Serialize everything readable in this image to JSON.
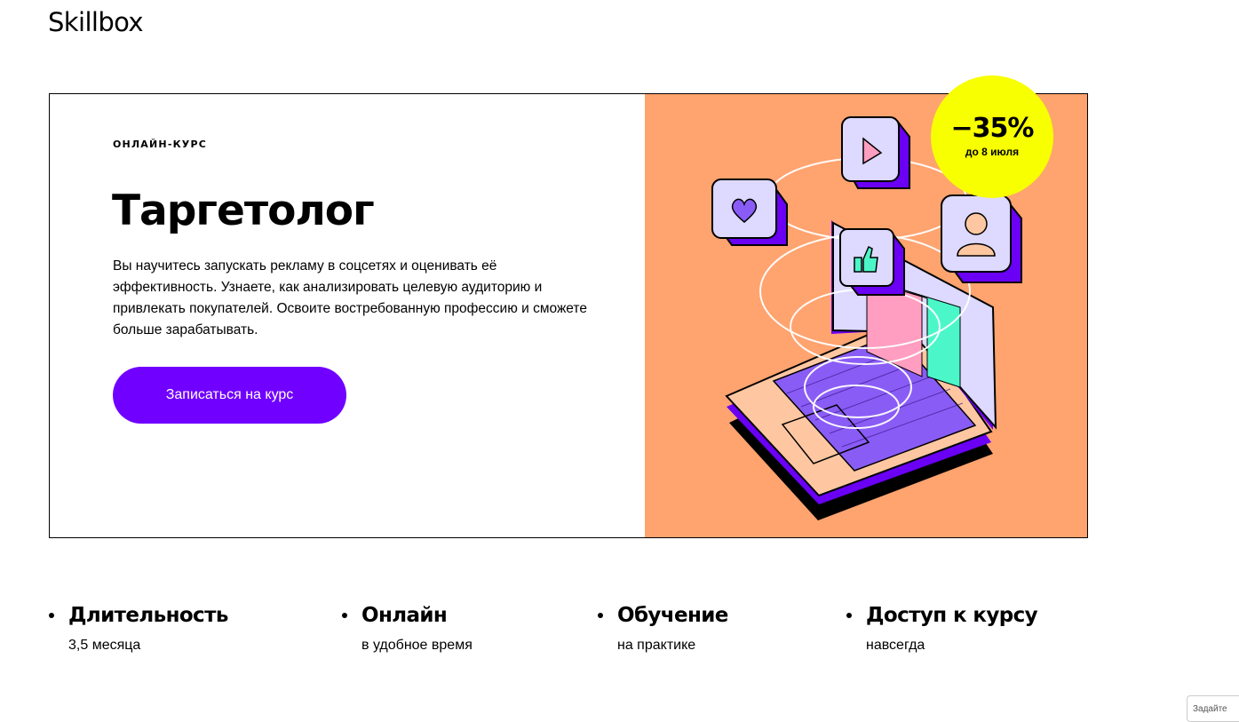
{
  "header": {
    "logo": "Skillbox"
  },
  "hero": {
    "eyebrow": "ОНЛАЙН-КУРС",
    "title": "Таргетолог",
    "description": "Вы научитесь запускать рекламу в соцсетях и оценивать её эффективность. Узнаете, как анализировать целевую аудиторию и привлекать покупателей. Освоите востребованную профессию и сможете больше зарабатывать.",
    "cta_label": "Записаться на курс",
    "badge": {
      "discount": "−35%",
      "until": "до 8 июля"
    },
    "colors": {
      "illustration_bg": "#ffa36f",
      "accent": "#7000ff",
      "badge": "#f8ff00"
    }
  },
  "features": [
    {
      "title": "Длительность",
      "subtitle": "3,5 месяца"
    },
    {
      "title": "Онлайн",
      "subtitle": "в удобное время"
    },
    {
      "title": "Обучение",
      "subtitle": "на практике"
    },
    {
      "title": "Доступ к курсу",
      "subtitle": "навсегда"
    }
  ],
  "corner_button": {
    "label": "Задайте"
  },
  "icons": [
    "heart-icon",
    "play-icon",
    "user-icon",
    "thumbs-up-icon",
    "laptop-illustration"
  ]
}
